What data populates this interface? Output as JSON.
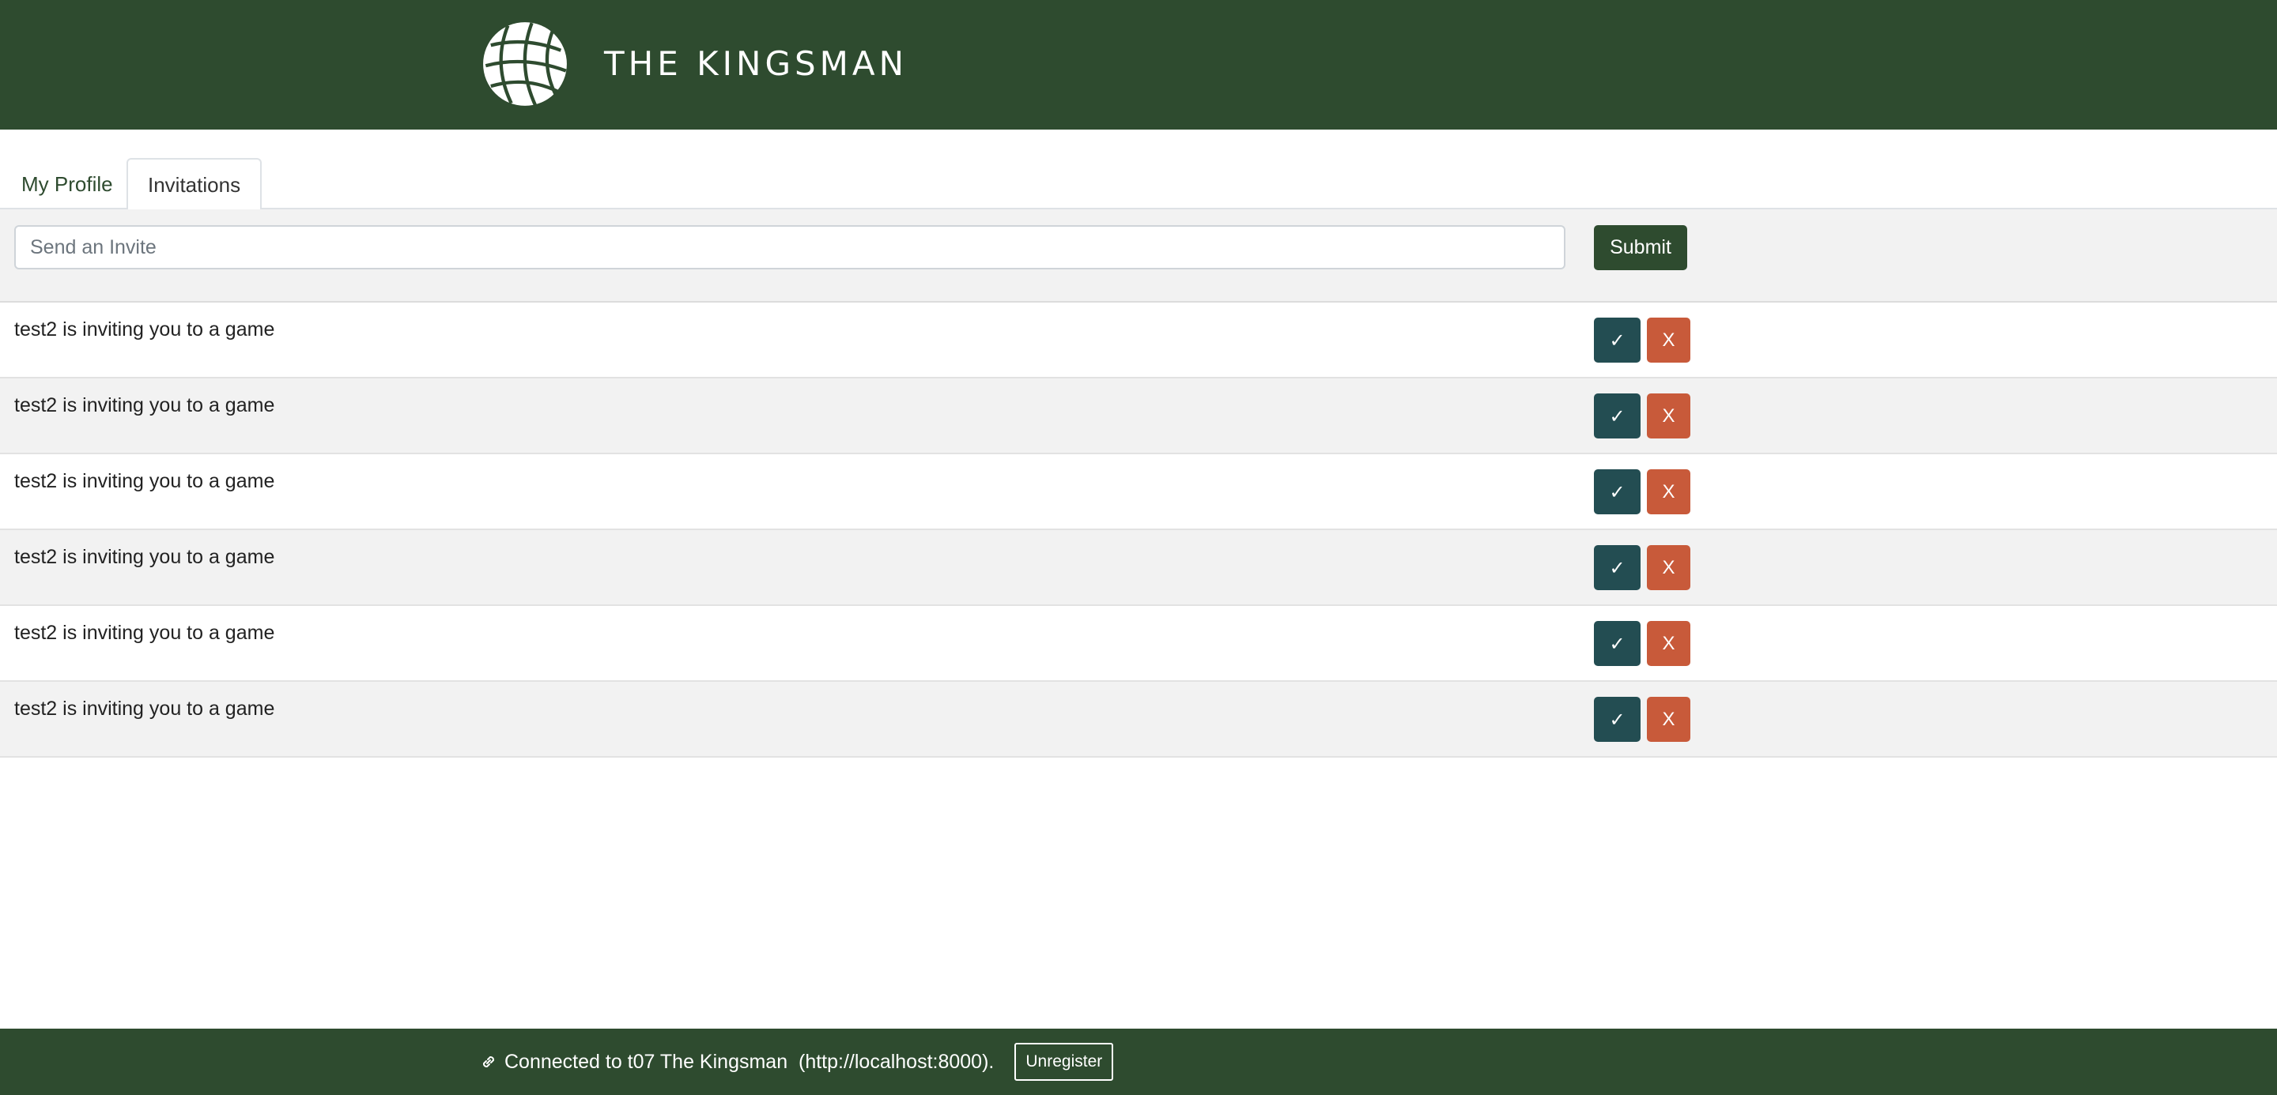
{
  "header": {
    "title": "THE KINGSMAN",
    "logo_icon": "globe-icon"
  },
  "tabs": [
    {
      "label": "My Profile",
      "active": false
    },
    {
      "label": "Invitations",
      "active": true
    }
  ],
  "invite_form": {
    "placeholder": "Send an Invite",
    "value": "",
    "submit_label": "Submit"
  },
  "invitations": [
    {
      "text": "test2 is inviting you to a game",
      "accept_label": "✓",
      "decline_label": "X"
    },
    {
      "text": "test2 is inviting you to a game",
      "accept_label": "✓",
      "decline_label": "X"
    },
    {
      "text": "test2 is inviting you to a game",
      "accept_label": "✓",
      "decline_label": "X"
    },
    {
      "text": "test2 is inviting you to a game",
      "accept_label": "✓",
      "decline_label": "X"
    },
    {
      "text": "test2 is inviting you to a game",
      "accept_label": "✓",
      "decline_label": "X"
    },
    {
      "text": "test2 is inviting you to a game",
      "accept_label": "✓",
      "decline_label": "X"
    }
  ],
  "footer": {
    "status_text": "Connected to t07 The Kingsman  (http://localhost:8000).",
    "status_icon": "link-icon",
    "unregister_label": "Unregister"
  },
  "colors": {
    "brand_green": "#2e4b2f",
    "accept_teal": "#234d52",
    "decline_orange": "#c85a3a",
    "row_alt": "#f2f2f2"
  }
}
